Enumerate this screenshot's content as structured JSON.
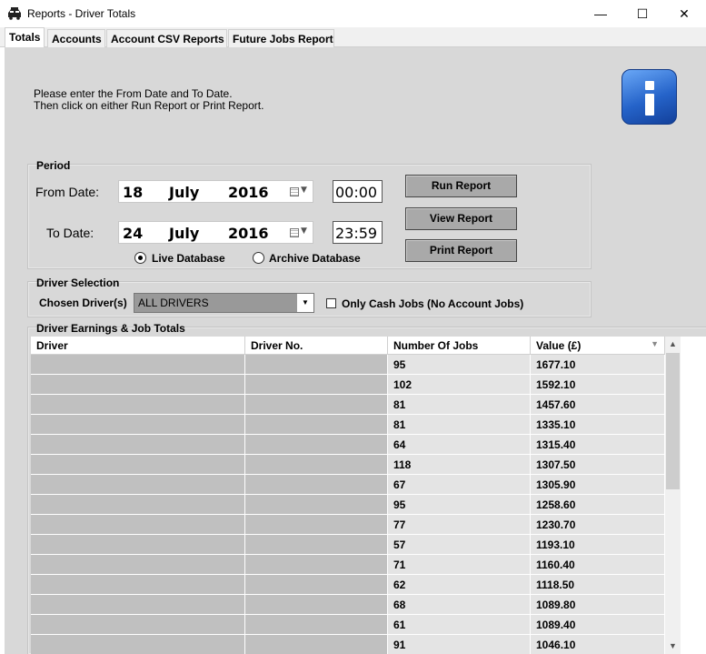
{
  "window": {
    "title": "Reports - Driver Totals",
    "minimize_glyph": "—",
    "maximize_glyph": "☐",
    "close_glyph": "✕"
  },
  "tabs": [
    {
      "label": "Totals",
      "active": true
    },
    {
      "label": "Accounts",
      "active": false
    },
    {
      "label": "Account CSV Reports",
      "active": false
    },
    {
      "label": "Future Jobs Report",
      "active": false
    }
  ],
  "instructions": {
    "line1": "Please enter the From Date and To Date.",
    "line2": "Then click on either Run Report or Print Report."
  },
  "period": {
    "label": "Period",
    "from_label": "From Date:",
    "from_day": "18",
    "from_month": "July",
    "from_year": "2016",
    "from_time": "00:00",
    "to_label": "To Date:",
    "to_day": "24",
    "to_month": "July",
    "to_year": "2016",
    "to_time": "23:59",
    "live_db_label": "Live Database",
    "archive_db_label": "Archive Database",
    "selected_db": "Live Database"
  },
  "buttons": {
    "run": "Run Report",
    "view": "View Report",
    "print": "Print Report"
  },
  "driver_selection": {
    "label": "Driver Selection",
    "chosen_label": "Chosen Driver(s)",
    "chosen_value": "ALL DRIVERS",
    "cash_only_label": "Only Cash Jobs (No Account Jobs)",
    "cash_only_checked": false
  },
  "earnings": {
    "label": "Driver Earnings & Job Totals",
    "columns": [
      "Driver",
      "Driver No.",
      "Number Of Jobs",
      "Value (£)"
    ],
    "rows": [
      {
        "driver": "",
        "driver_no": "",
        "jobs": "95",
        "value": "1677.10"
      },
      {
        "driver": "",
        "driver_no": "",
        "jobs": "102",
        "value": "1592.10"
      },
      {
        "driver": "",
        "driver_no": "",
        "jobs": "81",
        "value": "1457.60"
      },
      {
        "driver": "",
        "driver_no": "",
        "jobs": "81",
        "value": "1335.10"
      },
      {
        "driver": "",
        "driver_no": "",
        "jobs": "64",
        "value": "1315.40"
      },
      {
        "driver": "",
        "driver_no": "",
        "jobs": "118",
        "value": "1307.50"
      },
      {
        "driver": "",
        "driver_no": "",
        "jobs": "67",
        "value": "1305.90"
      },
      {
        "driver": "",
        "driver_no": "",
        "jobs": "95",
        "value": "1258.60"
      },
      {
        "driver": "",
        "driver_no": "",
        "jobs": "77",
        "value": "1230.70"
      },
      {
        "driver": "",
        "driver_no": "",
        "jobs": "57",
        "value": "1193.10"
      },
      {
        "driver": "",
        "driver_no": "",
        "jobs": "71",
        "value": "1160.40"
      },
      {
        "driver": "",
        "driver_no": "",
        "jobs": "62",
        "value": "1118.50"
      },
      {
        "driver": "",
        "driver_no": "",
        "jobs": "68",
        "value": "1089.80"
      },
      {
        "driver": "",
        "driver_no": "",
        "jobs": "61",
        "value": "1089.40"
      },
      {
        "driver": "",
        "driver_no": "",
        "jobs": "91",
        "value": "1046.10"
      }
    ]
  }
}
